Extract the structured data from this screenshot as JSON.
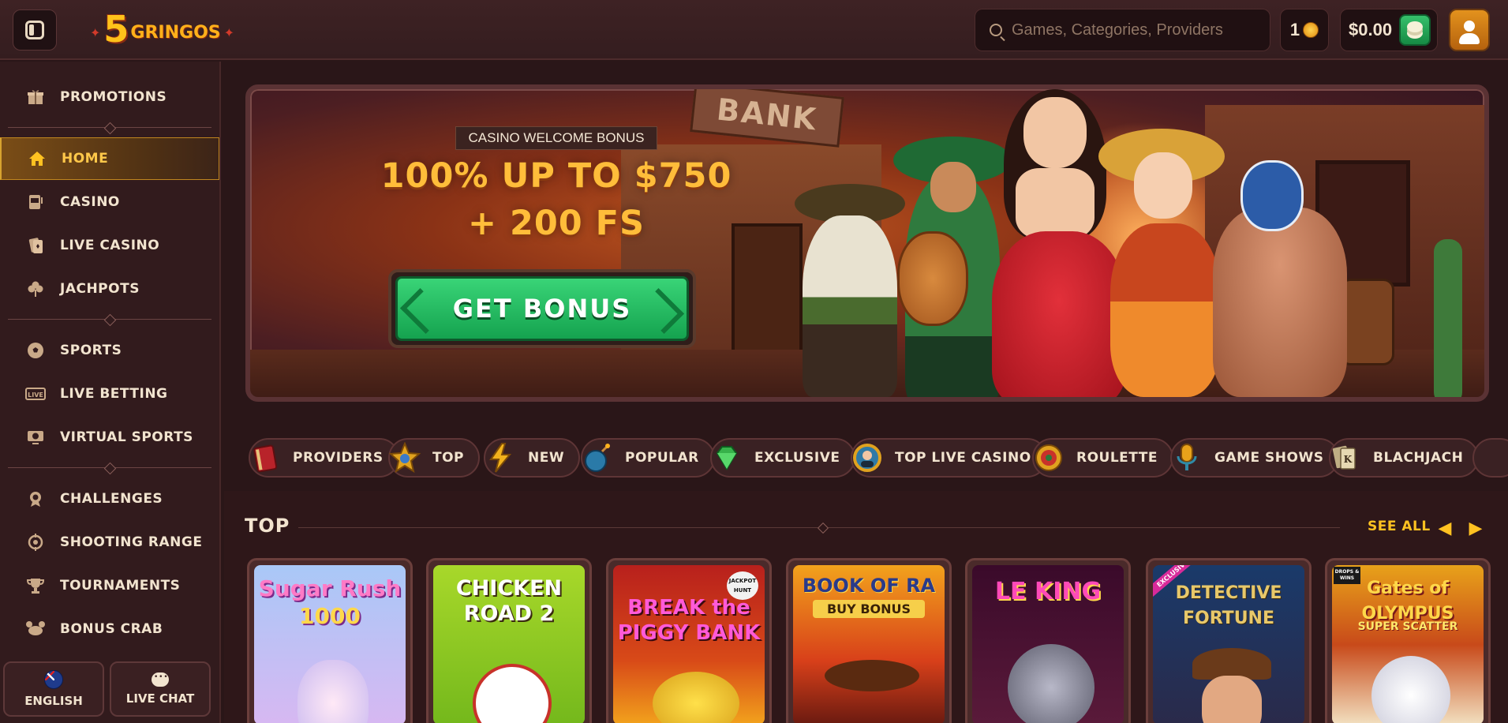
{
  "header": {
    "logo_number": "5",
    "logo_word": "GRINGOS",
    "search_placeholder": "Games, Categories, Providers",
    "coins_count": "1",
    "balance": "$0.00"
  },
  "sidebar": {
    "items": [
      {
        "label": "PROMOTIONS",
        "icon": "gift-icon"
      },
      {
        "label": "HOME",
        "icon": "home-icon"
      },
      {
        "label": "CASINO",
        "icon": "slot-machine-icon"
      },
      {
        "label": "LIVE CASINO",
        "icon": "cards-icon"
      },
      {
        "label": "JACHPOTS",
        "icon": "clover-icon"
      },
      {
        "label": "SPORTS",
        "icon": "soccer-ball-icon"
      },
      {
        "label": "LIVE BETTING",
        "icon": "live-tag-icon"
      },
      {
        "label": "VIRTUAL SPORTS",
        "icon": "monitor-ball-icon"
      },
      {
        "label": "CHALLENGES",
        "icon": "medal-icon"
      },
      {
        "label": "SHOOTING RANGE",
        "icon": "crosshair-icon"
      },
      {
        "label": "TOURNAMENTS",
        "icon": "trophy-icon"
      },
      {
        "label": "BONUS CRAB",
        "icon": "crab-icon"
      }
    ],
    "language_label": "ENGLISH",
    "chat_label": "LIVE CHAT"
  },
  "banner": {
    "kicker": "CASINO WELCOME BONUS",
    "headline_line1": "100% UP TO $750",
    "headline_line2": "+ 200 FS",
    "cta": "GET BONUS",
    "sign": "BANK"
  },
  "categories": [
    {
      "label": "PROVIDERS",
      "icon": "book-icon",
      "color": "#b8232a"
    },
    {
      "label": "TOP",
      "icon": "star-badge-icon",
      "color": "#e0a21f"
    },
    {
      "label": "NEW",
      "icon": "lightning-icon",
      "color": "#f2b21c"
    },
    {
      "label": "POPULAR",
      "icon": "bomb-icon",
      "color": "#2a7aa8"
    },
    {
      "label": "EXCLUSIVE",
      "icon": "gem-icon",
      "color": "#37b24a"
    },
    {
      "label": "TOP LIVE CASINO",
      "icon": "dealer-chip-icon",
      "color": "#2f7aa6"
    },
    {
      "label": "ROULETTE",
      "icon": "roulette-icon",
      "color": "#c8322a"
    },
    {
      "label": "GAME SHOWS",
      "icon": "microphone-icon",
      "color": "#e8a21a"
    },
    {
      "label": "BLACHJACH",
      "icon": "playing-cards-icon",
      "color": "#d9c9a0"
    }
  ],
  "top_section": {
    "title": "TOP",
    "see_all": "SEE ALL",
    "games": [
      {
        "title": "Sugar Rush",
        "subtitle": "1000",
        "badge": ""
      },
      {
        "title": "CHICKEN ROAD 2",
        "subtitle": "",
        "badge": ""
      },
      {
        "title": "BREAK the PIGGY BANK",
        "subtitle": "",
        "badge": "JACKPOT HUNT"
      },
      {
        "title": "BOOK OF RA",
        "subtitle": "BUY BONUS",
        "badge": ""
      },
      {
        "title": "LE KING",
        "subtitle": "",
        "badge": ""
      },
      {
        "title": "DETECTIVE FORTUNE",
        "subtitle": "",
        "badge": "EXCLUSIVE"
      },
      {
        "title": "Gates of OLYMPUS",
        "subtitle": "SUPER SCATTER",
        "badge": "DROPS & WINS"
      }
    ]
  },
  "colors": {
    "accent": "#ffc221",
    "cta_green": "#22b85c",
    "background": "#2a1618",
    "sidebar": "#321b1d"
  }
}
